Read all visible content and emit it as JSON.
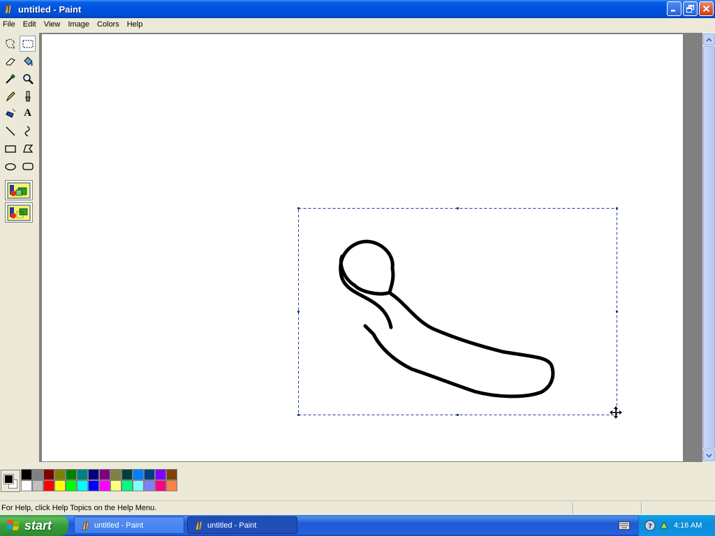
{
  "window": {
    "title": "untitled - Paint",
    "minimize_icon": "minimize-icon",
    "maximize_icon": "restore-icon",
    "close_icon": "close-icon"
  },
  "menu": [
    "File",
    "Edit",
    "View",
    "Image",
    "Colors",
    "Help"
  ],
  "tools": [
    {
      "name": "free-form-select",
      "icon": "free-form-select-icon"
    },
    {
      "name": "select",
      "icon": "rect-select-icon",
      "selected": true
    },
    {
      "name": "eraser",
      "icon": "eraser-icon"
    },
    {
      "name": "fill-with-color",
      "icon": "paint-bucket-icon"
    },
    {
      "name": "pick-color",
      "icon": "eyedropper-icon"
    },
    {
      "name": "magnifier",
      "icon": "magnifier-icon"
    },
    {
      "name": "pencil",
      "icon": "pencil-icon"
    },
    {
      "name": "brush",
      "icon": "brush-icon"
    },
    {
      "name": "airbrush",
      "icon": "airbrush-icon"
    },
    {
      "name": "text",
      "icon": "text-icon",
      "glyph": "A"
    },
    {
      "name": "line",
      "icon": "line-icon"
    },
    {
      "name": "curve",
      "icon": "curve-icon"
    },
    {
      "name": "rectangle",
      "icon": "rectangle-icon"
    },
    {
      "name": "polygon",
      "icon": "polygon-icon"
    },
    {
      "name": "ellipse",
      "icon": "ellipse-icon"
    },
    {
      "name": "rounded-rectangle",
      "icon": "rounded-rectangle-icon"
    }
  ],
  "colors": {
    "foreground": "#000000",
    "background": "#ffffff",
    "palette": [
      "#000000",
      "#808080",
      "#800000",
      "#808000",
      "#008000",
      "#008080",
      "#000080",
      "#800080",
      "#808040",
      "#004040",
      "#0080ff",
      "#004080",
      "#8000ff",
      "#804000",
      "#ffffff",
      "#c0c0c0",
      "#ff0000",
      "#ffff00",
      "#00ff00",
      "#00ffff",
      "#0000ff",
      "#ff00ff",
      "#ffff80",
      "#00ff80",
      "#80ffff",
      "#8080ff",
      "#ff0080",
      "#ff8040"
    ]
  },
  "status": {
    "help_text": "For Help, click Help Topics on the Help Menu."
  },
  "taskbar": {
    "start_label": "start",
    "tasks": [
      {
        "label": "untitled - Paint",
        "active": false
      },
      {
        "label": "untitled - Paint",
        "active": true
      }
    ],
    "tray_icons": [
      "keyboard-icon",
      "help-tray-icon",
      "network-tray-icon"
    ],
    "clock": "4:16 AM"
  }
}
